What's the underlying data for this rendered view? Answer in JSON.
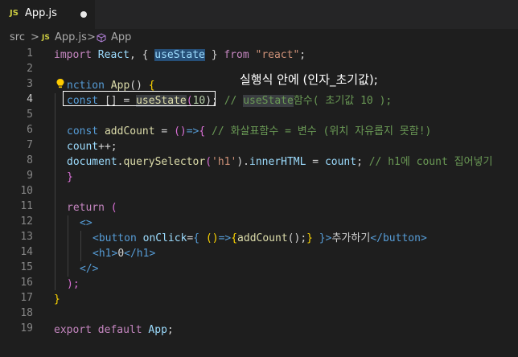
{
  "tab": {
    "icon_text": "JS",
    "filename": "App.js",
    "unsaved_dot": "modified-dot"
  },
  "breadcrumb": {
    "folder": "src",
    "sep1": ">",
    "icon_text": "JS",
    "file": "App.js",
    "sep2": ">",
    "symbol": "App"
  },
  "annotation": "실행식 안에 (인자_초기값);",
  "lines": [
    {
      "n": "1"
    },
    {
      "n": "2"
    },
    {
      "n": "3"
    },
    {
      "n": "4"
    },
    {
      "n": "5"
    },
    {
      "n": "6"
    },
    {
      "n": "7"
    },
    {
      "n": "8"
    },
    {
      "n": "9"
    },
    {
      "n": "10"
    },
    {
      "n": "11"
    },
    {
      "n": "12"
    },
    {
      "n": "13"
    },
    {
      "n": "14"
    },
    {
      "n": "15"
    },
    {
      "n": "16"
    },
    {
      "n": "17"
    },
    {
      "n": "18"
    },
    {
      "n": "19"
    }
  ],
  "code": {
    "l1": {
      "a": "import",
      "b": "React",
      "c": ", { ",
      "d": "useState",
      "e": " } ",
      "f": "from",
      "g": "\"react\"",
      "h": ";"
    },
    "l3": {
      "a": "nction",
      "b": " ",
      "c": "App",
      "d": "() ",
      "e": "{"
    },
    "l4": {
      "a": "const",
      "b": " [] = ",
      "c": "useState",
      "d": "(",
      "e": "10",
      "f": ");",
      "g": " // ",
      "h": "useState",
      "i": "함수( 초기값 10 );"
    },
    "l6": {
      "a": "const",
      "b": " ",
      "c": "addCount",
      "d": " = ",
      "e": "()",
      "f": "=>",
      "g": "{",
      "h": " // 화살표함수 = 변수 (위치 자유롭지 못함!)"
    },
    "l7": {
      "a": "count",
      "b": "++;"
    },
    "l8": {
      "a": "document",
      "b": ".",
      "c": "querySelector",
      "d": "(",
      "e": "'h1'",
      "f": ").",
      "g": "innerHTML",
      "h": " = ",
      "i": "count",
      "j": ";",
      "k": " // h1에 count 집어넣기"
    },
    "l9": {
      "a": "}"
    },
    "l11": {
      "a": "return",
      "b": " ("
    },
    "l12": {
      "a": "<>"
    },
    "l13": {
      "a": "<",
      "b": "button",
      "c": " ",
      "d": "onClick",
      "e": "=",
      "f": "{",
      "g": " ()",
      "h": "=>",
      "i": "{",
      "j": "addCount",
      "k": "();",
      "l": "}",
      "m": " }",
      ">": ">",
      "n": "추가하기",
      "o": "</",
      "p": "button",
      "q": ">"
    },
    "l14": {
      "a": "<",
      "b": "h1",
      "c": ">",
      "d": "0",
      "e": "</",
      "f": "h1",
      "g": ">"
    },
    "l15": {
      "a": "</>"
    },
    "l16": {
      "a": ");"
    },
    "l17": {
      "a": "}"
    },
    "l19": {
      "a": "export",
      "b": " ",
      "c": "default",
      "d": " ",
      "e": "App",
      "f": ";"
    }
  }
}
